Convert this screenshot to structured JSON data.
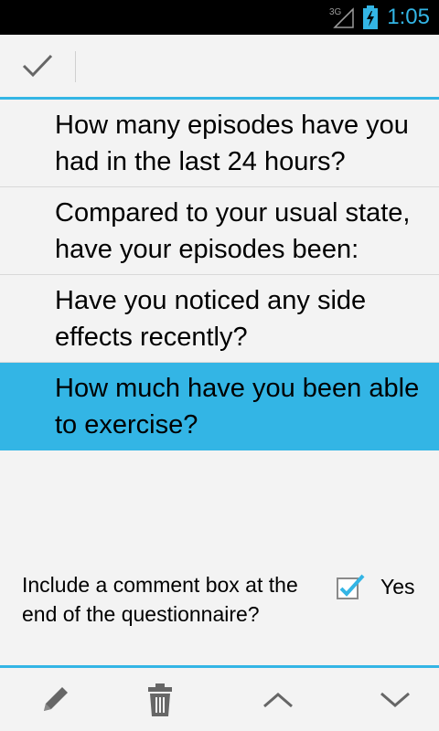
{
  "status_bar": {
    "network_label": "3G",
    "time": "1:05"
  },
  "action_bar": {
    "done_icon": "check-icon"
  },
  "questions": [
    {
      "text": "How many episodes have you had in the last 24 hours?",
      "selected": false
    },
    {
      "text": "Compared to your usual state, have your episodes been:",
      "selected": false
    },
    {
      "text": "Have you noticed any side effects recently?",
      "selected": false
    },
    {
      "text": "How much have you been able to exercise?",
      "selected": true
    }
  ],
  "comment_option": {
    "label": "Include a comment box at the end of the questionnaire?",
    "checked": true,
    "checkbox_label": "Yes"
  },
  "bottom_bar": {
    "icons": [
      "pencil-icon",
      "trash-icon",
      "chevron-up-icon",
      "chevron-down-icon"
    ]
  },
  "colors": {
    "accent": "#33b5e5",
    "background": "#f3f3f3"
  }
}
